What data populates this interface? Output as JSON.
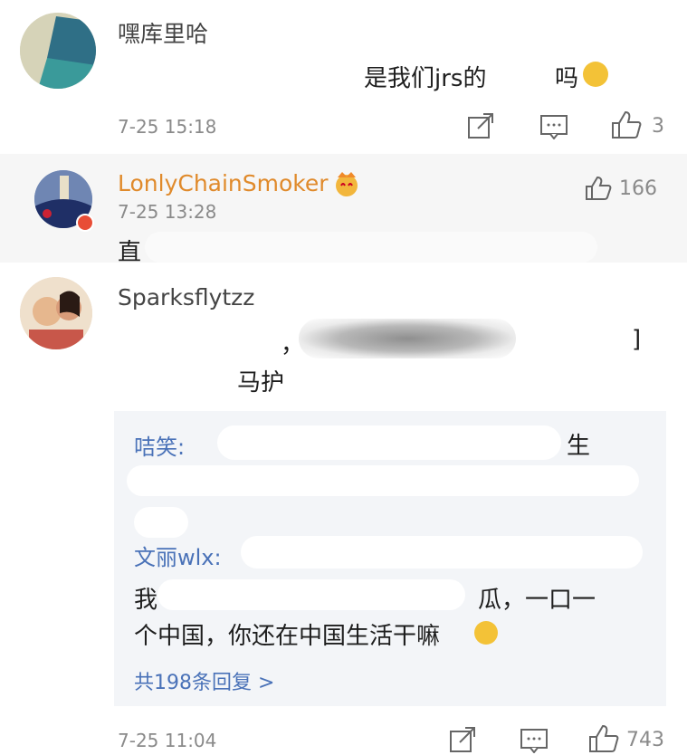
{
  "comments": [
    {
      "author": "嘿库里哈",
      "text_visible": "是我们jrs的",
      "text_tail": "吗",
      "time": "7-25 15:18",
      "likes": "3"
    },
    {
      "author": "LonlyChainSmoker",
      "time": "7-25 13:28",
      "likes": "166",
      "text_fragment": "直"
    },
    {
      "author": "Sparksflytzz",
      "text_line1_tail": "，",
      "text_line1_end": "]",
      "text_line2": "马护",
      "replies": [
        {
          "author": "咭笑:",
          "text_tail": "生"
        },
        {
          "author": "文丽wlx:",
          "text_line2_start": "我",
          "text_line2_end": "瓜，一口一",
          "text_line3": "个中国，你还在中国生活干嘛"
        }
      ],
      "more_replies": "共198条回复 >",
      "time": "7-25 11:04",
      "likes": "743"
    }
  ],
  "colors": {
    "vip_name": "#e08a2b",
    "reply_author": "#4a72b8",
    "reply_box": "#f3f5f8",
    "highlight_bg": "#f6f6f6"
  }
}
